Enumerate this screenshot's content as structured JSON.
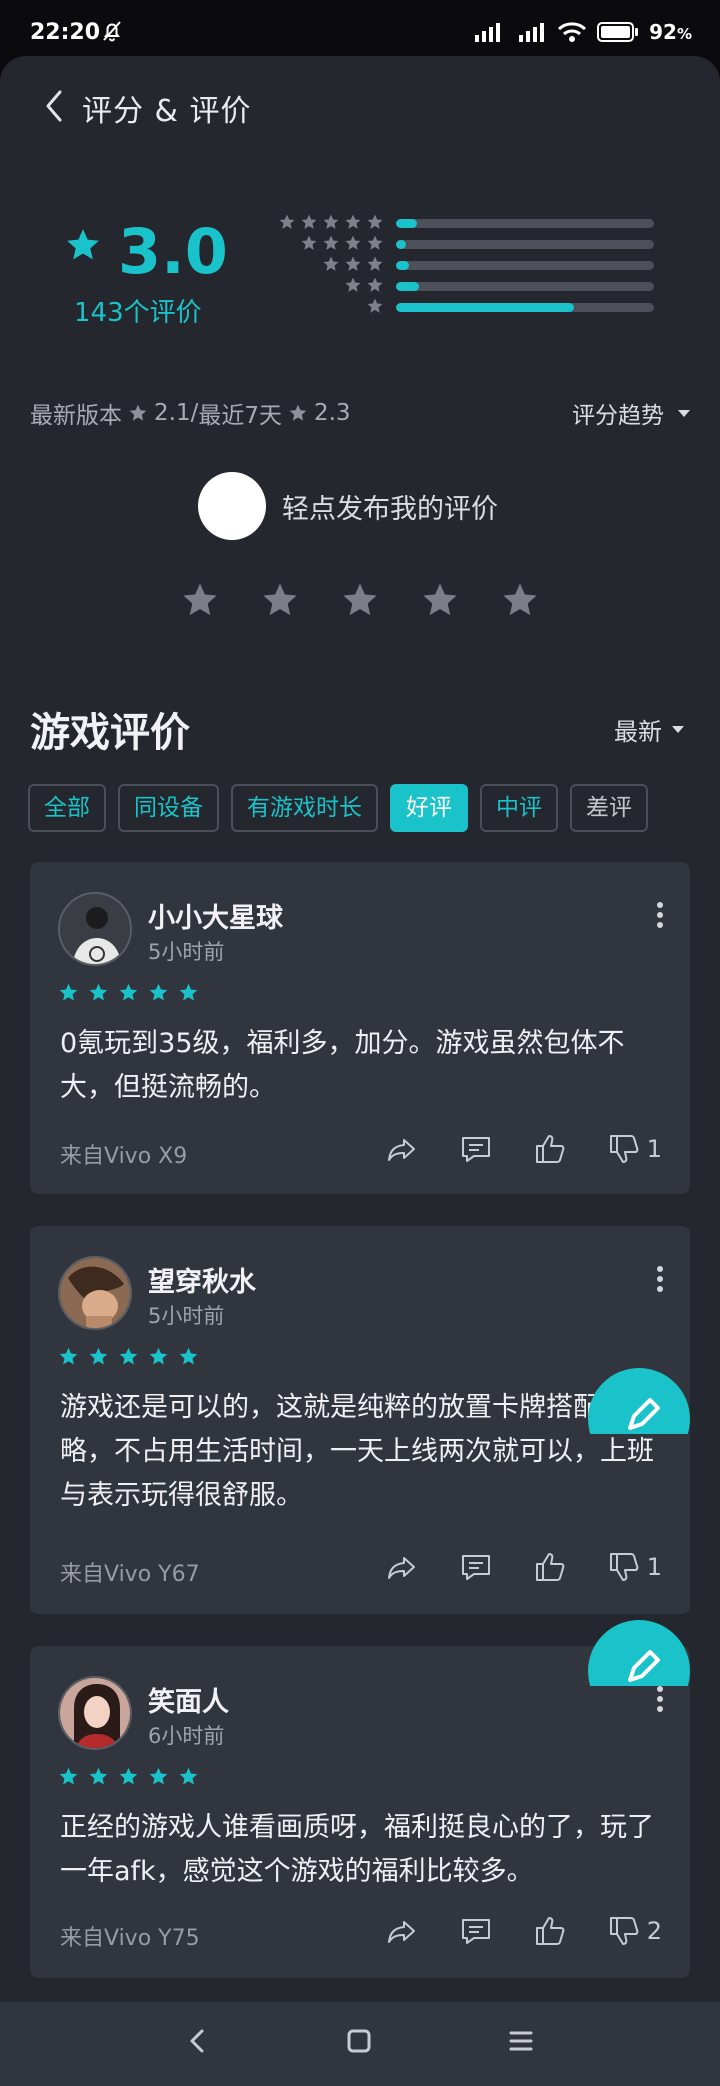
{
  "status_bar": {
    "time": "22:20",
    "battery": "92"
  },
  "header": {
    "title": "评分 & 评价"
  },
  "rating": {
    "score": "3.0",
    "count_label": "143个评价",
    "distribution": [
      {
        "stars": 5,
        "fraction": 0.08
      },
      {
        "stars": 4,
        "fraction": 0.04
      },
      {
        "stars": 3,
        "fraction": 0.05
      },
      {
        "stars": 2,
        "fraction": 0.09
      },
      {
        "stars": 1,
        "fraction": 0.69
      }
    ],
    "latest_version_label": "最新版本",
    "latest_version_score": "2.1",
    "separator": "/",
    "recent_label": "最近7天",
    "recent_score": "2.3",
    "trend_label": "评分趋势"
  },
  "my_review": {
    "prompt": "轻点发布我的评价"
  },
  "reviews_section": {
    "title": "游戏评价",
    "sort_label": "最新",
    "filters": [
      "全部",
      "同设备",
      "有游戏时长",
      "好评",
      "中评",
      "差评"
    ],
    "active_filter": "好评"
  },
  "reviews": [
    {
      "name": "小小大星球",
      "time": "5小时前",
      "stars": 5,
      "content": "0氪玩到35级，福利多，加分。游戏虽然包体不大，但挺流畅的。",
      "device": "来自Vivo X9",
      "dislikes": "1"
    },
    {
      "name": "望穿秋水",
      "time": "5小时前",
      "stars": 5,
      "content": "游戏还是可以的，这就是纯粹的放置卡牌搭配策略，不占用生活时间，一天上线两次就可以，上班与表示玩得很舒服。",
      "device": "来自Vivo Y67",
      "dislikes": "1"
    },
    {
      "name": "笑面人",
      "time": "6小时前",
      "stars": 5,
      "content": "正经的游戏人谁看画质呀，福利挺良心的了，玩了一年afk，感觉这个游戏的福利比较多。",
      "device": "来自Vivo Y75",
      "dislikes": "2"
    }
  ],
  "colors": {
    "accent": "#19c3c9",
    "background": "#24272e",
    "card": "#31353e"
  },
  "icons": [
    "back-icon",
    "star-icon",
    "share-icon",
    "comment-icon",
    "thumbs-up-icon",
    "thumbs-down-icon",
    "edit-icon",
    "more-icon"
  ]
}
